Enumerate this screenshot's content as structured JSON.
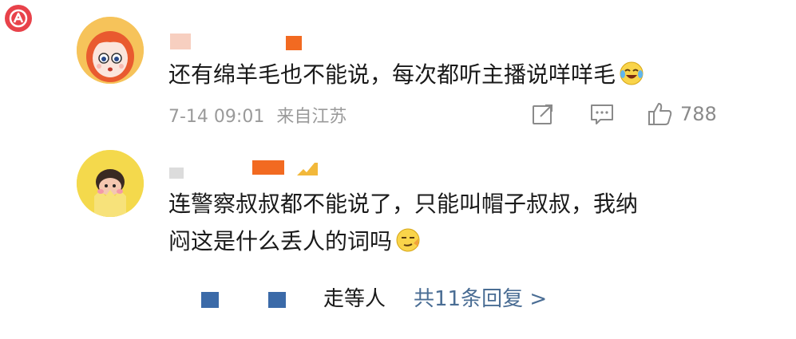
{
  "comments": [
    {
      "text": "还有绵羊毛也不能说，每次都听主播说咩咩毛",
      "emoji": "laughing-tears-emoji",
      "time": "7-14 09:01",
      "location": "来自江苏",
      "likes": "788"
    },
    {
      "line1": "连警察叔叔都不能说了，只能叫帽子叔叔，我纳",
      "line2": "闷这是什么丢人的词吗",
      "emoji": "smirk-emoji"
    }
  ],
  "replies": {
    "text": "走等人",
    "link": "共11条回复 >"
  },
  "colors": {
    "logo": "#e8424a",
    "link": "#4a6d94",
    "meta": "#9a9a9a",
    "blur_orange": "#f26a21",
    "blur_blue": "#3b6aa8"
  }
}
